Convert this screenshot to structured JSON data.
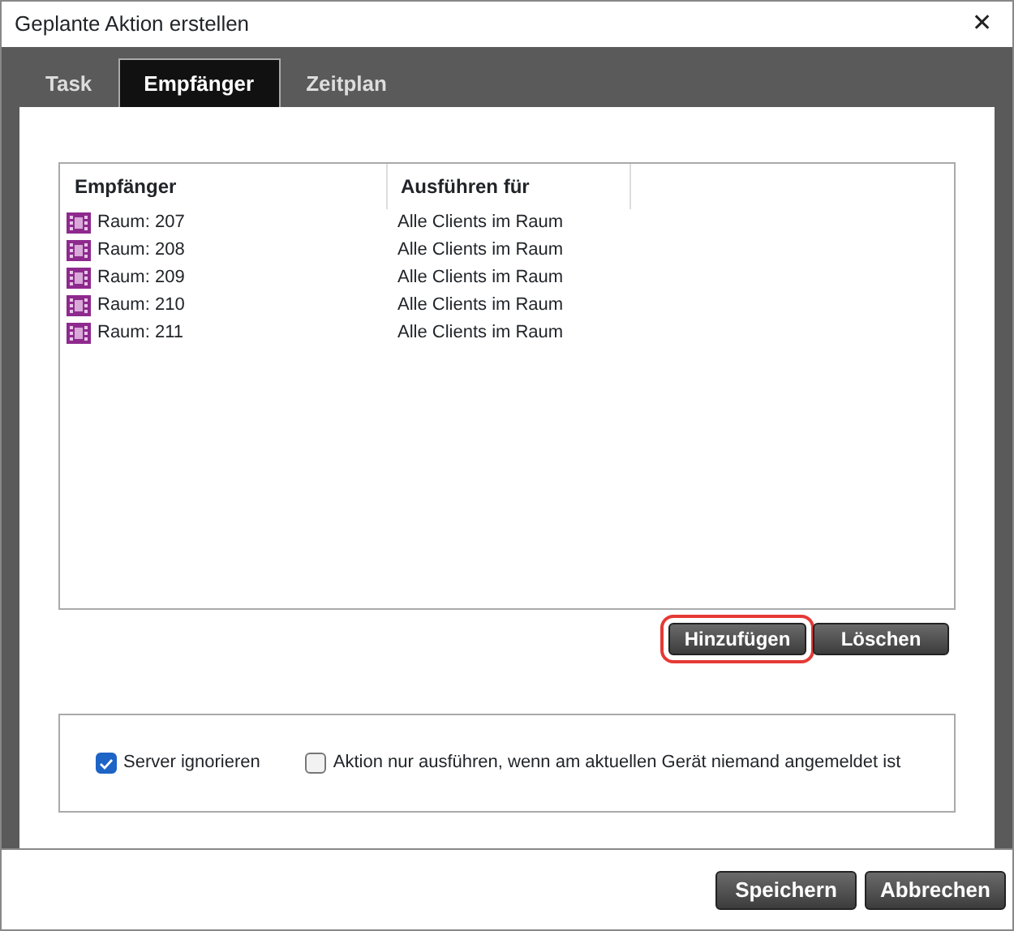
{
  "window": {
    "title": "Geplante Aktion erstellen",
    "close": "✕"
  },
  "tabs": [
    {
      "label": "Task",
      "selected": false
    },
    {
      "label": "Empfänger",
      "selected": true
    },
    {
      "label": "Zeitplan",
      "selected": false
    }
  ],
  "table": {
    "columns": [
      "Empfänger",
      "Ausführen für"
    ],
    "rows": [
      {
        "name": "Raum: 207",
        "target": "Alle Clients im Raum"
      },
      {
        "name": "Raum: 208",
        "target": "Alle Clients im Raum"
      },
      {
        "name": "Raum: 209",
        "target": "Alle Clients im Raum"
      },
      {
        "name": "Raum: 210",
        "target": "Alle Clients im Raum"
      },
      {
        "name": "Raum: 211",
        "target": "Alle Clients im Raum"
      }
    ]
  },
  "table_buttons": [
    {
      "label": "Hinzufügen",
      "highlighted": true
    },
    {
      "label": "Löschen",
      "highlighted": false
    }
  ],
  "options": [
    {
      "label": "Server ignorieren",
      "checked": true
    },
    {
      "label": "Aktion nur ausführen, wenn am aktuellen Gerät niemand angemeldet ist",
      "checked": false
    }
  ],
  "footer_buttons": [
    "Speichern",
    "Abbrechen"
  ]
}
